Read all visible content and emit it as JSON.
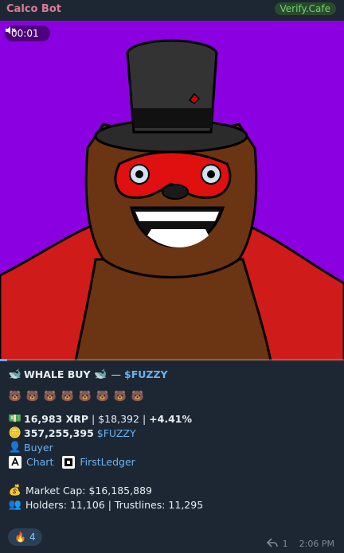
{
  "header": {
    "sender": "Calco Bot",
    "badge": "Verify.Cafe"
  },
  "media": {
    "time": "00:01",
    "mute_icon": "mute-icon",
    "progress_fraction": 0.02
  },
  "message": {
    "title_prefix": "WHALE BUY",
    "title_sep": "—",
    "title_token": "$FUZZY",
    "bear_emojis": [
      "🐻",
      "🐻",
      "🐻",
      "🐻",
      "🐻",
      "🐻",
      "🐻",
      "🐻"
    ],
    "amount_xrp": "16,983 XRP",
    "amount_usd": "$18,392",
    "change": "+4.41%",
    "tokens_amount": "357,255,395",
    "tokens_symbol": "$FUZZY",
    "buyer_label": "Buyer",
    "chart_label": "Chart",
    "firstledger_label": "FirstLedger",
    "market_cap": "Market Cap: $16,185,889",
    "holders": "Holders: 11,106 | Trustlines: 11,295"
  },
  "reaction": {
    "emoji": "🔥",
    "count": "4"
  },
  "footer": {
    "reply_count": "1",
    "time": "2:06 PM"
  },
  "colors": {
    "accent": "#6ab3f3",
    "bg": "#1c2733",
    "media_bg": "#8a00e0"
  }
}
